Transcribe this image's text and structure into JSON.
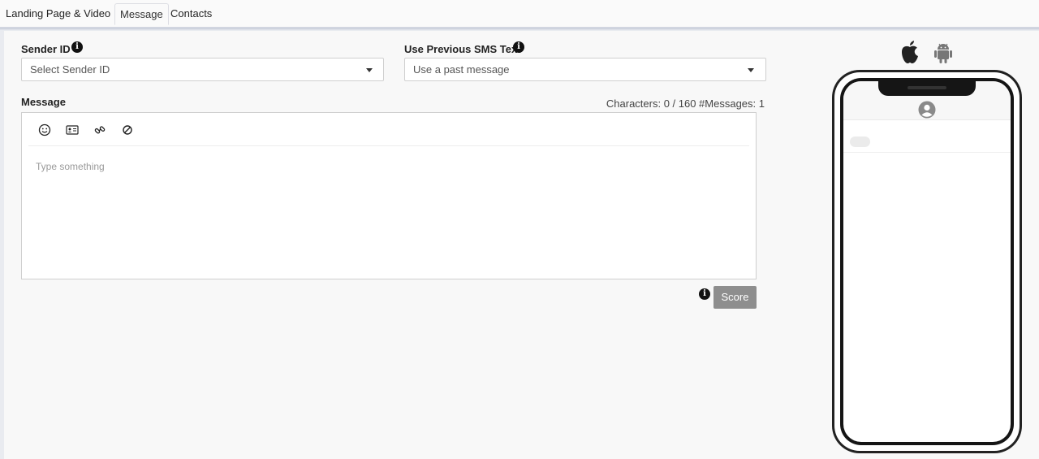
{
  "tabs": [
    {
      "label": "Landing Page & Video",
      "active": false
    },
    {
      "label": "Message",
      "active": true
    },
    {
      "label": "Contacts",
      "active": false
    }
  ],
  "sender": {
    "label": "Sender ID",
    "placeholder": "Select Sender ID"
  },
  "previous": {
    "label": "Use Previous SMS Text",
    "placeholder": "Use a past message"
  },
  "message": {
    "label": "Message",
    "counter": "Characters: 0 / 160 #Messages: 1",
    "placeholder": "Type something",
    "toolbar": [
      "emoji-icon",
      "contact-card-icon",
      "link-icon",
      "opt-out-icon"
    ]
  },
  "score": {
    "label": "Score"
  },
  "preview": {
    "platforms": [
      "apple-icon",
      "android-icon"
    ]
  },
  "colors": {
    "score_button": "#8e8e8e",
    "phone_frame": "#222222",
    "info_icon": "#111111"
  }
}
